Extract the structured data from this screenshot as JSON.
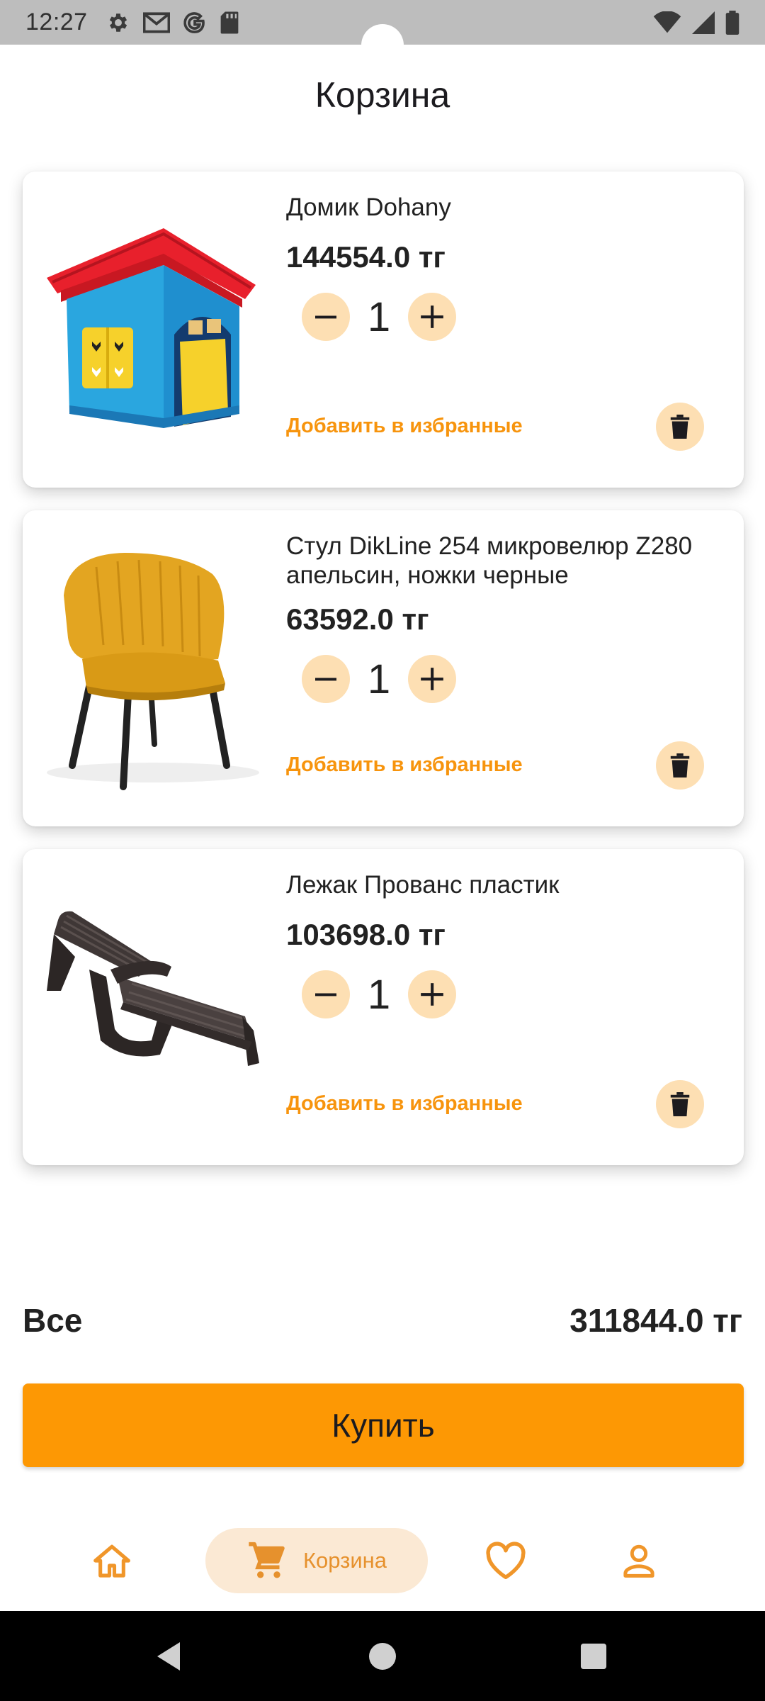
{
  "status_bar": {
    "time": "12:27"
  },
  "header": {
    "title": "Корзина"
  },
  "cart": {
    "items": [
      {
        "name": "Домик Dohany",
        "price": "144554.0 тг",
        "quantity": "1",
        "favorite_label": "Добавить в избранные"
      },
      {
        "name": " Стул DikLine 254 микровелюр Z280 апельсин, ножки черные",
        "price": "63592.0 тг",
        "quantity": "1",
        "favorite_label": "Добавить в избранные"
      },
      {
        "name": "Лежак Прованс пластик",
        "price": "103698.0 тг",
        "quantity": "1",
        "favorite_label": "Добавить в избранные"
      }
    ]
  },
  "total": {
    "label": "Все",
    "value": "311844.0 тг"
  },
  "buy_button": {
    "label": "Купить"
  },
  "bottom_nav": {
    "items": [
      {
        "icon": "home-icon",
        "label": ""
      },
      {
        "icon": "cart-icon",
        "label": "Корзина",
        "active": true
      },
      {
        "icon": "heart-icon",
        "label": ""
      },
      {
        "icon": "person-icon",
        "label": ""
      }
    ]
  },
  "colors": {
    "accent": "#fd9804",
    "accent_light": "#fddfb3",
    "link": "#f7940d",
    "nav_active_bg": "#fbe9d4"
  }
}
